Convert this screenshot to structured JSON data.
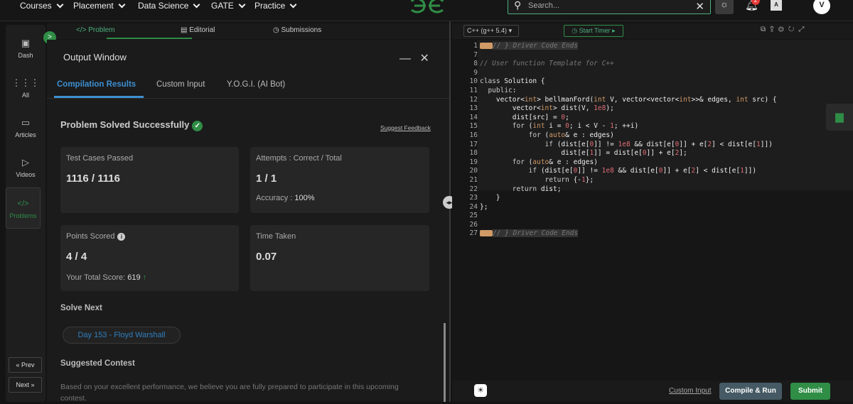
{
  "nav": {
    "items": [
      "Courses",
      "Placement",
      "Data Science",
      "GATE",
      "Practice"
    ],
    "search_placeholder": "Search...",
    "notification_count": "2",
    "lang_icon": "A",
    "avatar": "V"
  },
  "sidebar": {
    "items": [
      {
        "label": "Dash",
        "icon": "dashboard-icon"
      },
      {
        "label": "All",
        "icon": "grid-icon"
      },
      {
        "label": "Articles",
        "icon": "book-icon"
      },
      {
        "label": "Videos",
        "icon": "video-icon"
      },
      {
        "label": "Problems",
        "icon": "code-icon"
      }
    ],
    "prev": "« Prev",
    "next": "Next »"
  },
  "tabs": {
    "problem": "</> Problem",
    "editorial": "Editorial",
    "submissions": "Submissions"
  },
  "output": {
    "title": "Output Window",
    "tabs": [
      "Compilation Results",
      "Custom Input",
      "Y.O.G.I. (AI Bot)"
    ],
    "status": "Problem Solved Successfully",
    "feedback": "Suggest Feedback",
    "cards": {
      "tests_label": "Test Cases Passed",
      "tests_value": "1116 / 1116",
      "attempts_label": "Attempts : Correct / Total",
      "attempts_value": "1 / 1",
      "accuracy_label": "Accuracy :",
      "accuracy_value": "100%",
      "points_label": "Points Scored",
      "points_value": "4 / 4",
      "total_label": "Your Total Score:",
      "total_value": "619",
      "time_label": "Time Taken",
      "time_value": "0.07"
    },
    "solve_next_heading": "Solve Next",
    "solve_next_chip": "Day 153 - Floyd Warshall",
    "suggested_heading": "Suggested Contest",
    "suggested_text": "Based on your excellent performance, we believe you are fully prepared to participate in this upcoming contest."
  },
  "editor": {
    "language": "C++ (g++ 5.4)",
    "timer": "Start Timer",
    "line_numbers": [
      "1",
      "7",
      "8",
      "9",
      "10",
      "11",
      "12",
      "13",
      "14",
      "15",
      "16",
      "17",
      "18",
      "19",
      "20",
      "21",
      "22",
      "23",
      "24",
      "25",
      "26",
      "27"
    ],
    "custom_input": "Custom Input",
    "compile_run": "Compile & Run",
    "submit": "Submit"
  },
  "colors": {
    "accent": "#2f8d46",
    "tab_blue": "#3d8fd1"
  }
}
